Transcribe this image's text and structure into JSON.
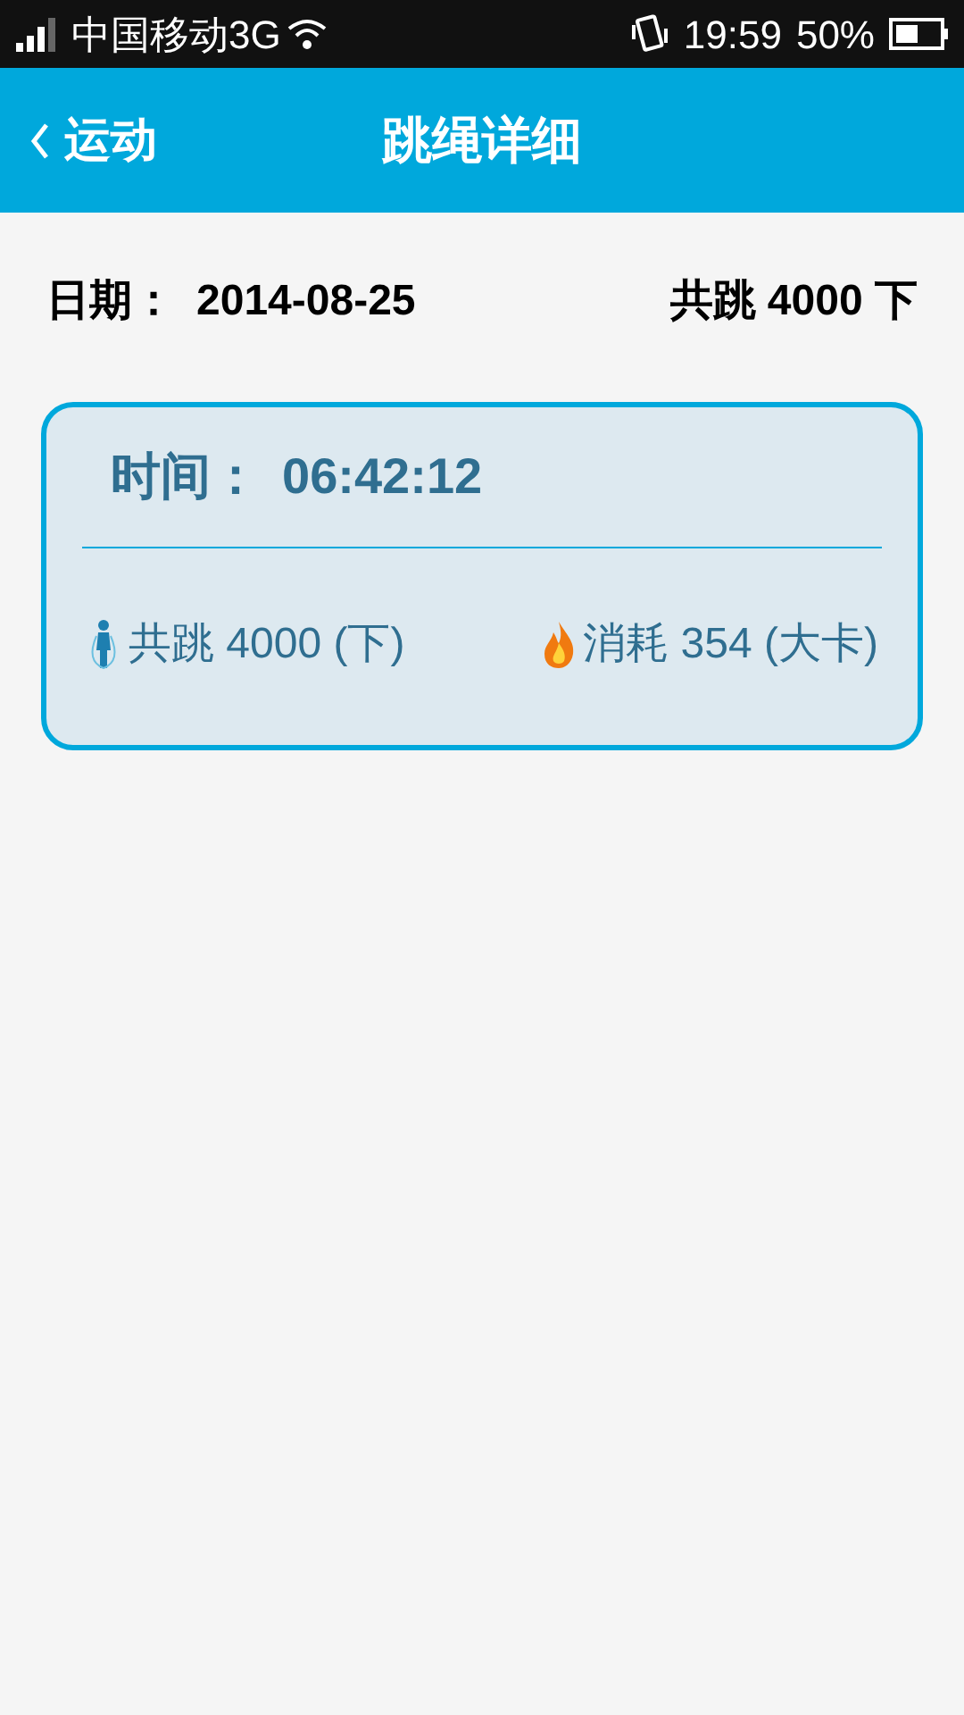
{
  "status_bar": {
    "carrier": "中国移动3G",
    "time": "19:59",
    "battery": "50%"
  },
  "nav": {
    "back": "运动",
    "title": "跳绳详细"
  },
  "summary": {
    "date_label": "日期：",
    "date": "2014-08-25",
    "total": "共跳 4000 下"
  },
  "record": {
    "time_label": "时间：",
    "time": "06:42:12",
    "jumps": "共跳 4000 (下)",
    "calories": "消耗 354 (大卡)"
  }
}
